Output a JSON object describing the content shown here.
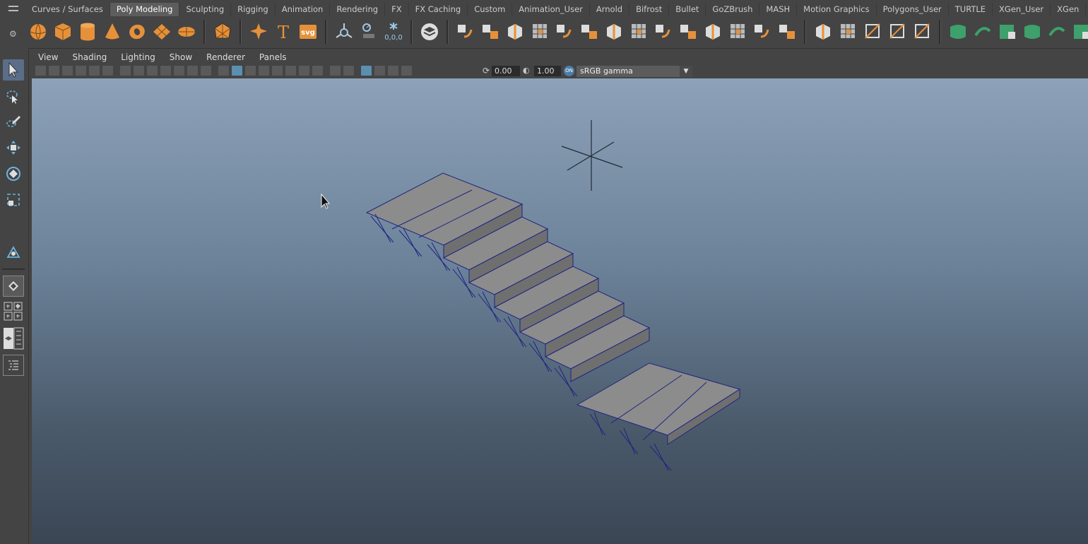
{
  "shelf_tabs": [
    "Curves / Surfaces",
    "Poly Modeling",
    "Sculpting",
    "Rigging",
    "Animation",
    "Rendering",
    "FX",
    "FX Caching",
    "Custom",
    "Animation_User",
    "Arnold",
    "Bifrost",
    "Bullet",
    "GoZBrush",
    "MASH",
    "Motion Graphics",
    "Polygons_User",
    "TURTLE",
    "XGen_User",
    "XGen"
  ],
  "active_tab": "Poly Modeling",
  "shelf_icons": [
    "sphere-icon",
    "cube-icon",
    "cylinder-icon",
    "cone-icon",
    "torus-icon",
    "plane-icon",
    "disc-icon",
    "platonic-icon",
    "superellipse-icon",
    "text-icon",
    "svg-icon",
    "measure-icon",
    "snap-icon",
    "coordinates-icon",
    "layer-icon",
    "combine-icon",
    "separate-icon",
    "smooth-icon",
    "bevel-icon",
    "mirror-icon",
    "boolean-icon",
    "extrude-icon",
    "bridge-icon",
    "merge-icon",
    "fill-hole-icon",
    "wedge-icon",
    "poke-icon",
    "chamfer-icon",
    "triangulate-icon",
    "quadrangulate-icon",
    "unfold-icon",
    "multicut-icon",
    "insert-loop-icon",
    "offset-loop-icon",
    "uv-editor-icon",
    "planar-uv-icon",
    "cylindrical-uv-icon",
    "spherical-uv-icon",
    "auto-uv-icon",
    "cut-uv-icon",
    "sew-uv-icon",
    "checker-icon"
  ],
  "text_icon_glyph": "T",
  "svg_icon_label": "svg",
  "coords_label": "0,0,0",
  "panel_menu": [
    "View",
    "Shading",
    "Lighting",
    "Show",
    "Renderer",
    "Panels"
  ],
  "exposure_value": "0.00",
  "gamma_value": "1.00",
  "colorspace": "sRGB gamma",
  "colorspace_toggle": "ON",
  "accent_color": "#e6913a",
  "stair_color": "#8c8c8c"
}
